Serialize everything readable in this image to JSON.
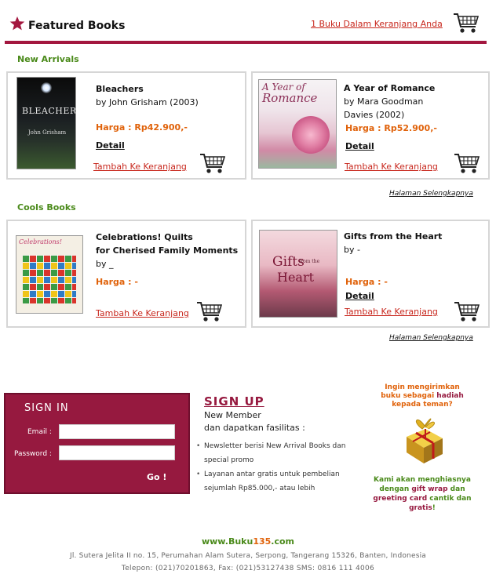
{
  "header": {
    "title": "Featured Books",
    "cart_link": "1 Buku Dalam Keranjang Anda"
  },
  "new_arrivals": {
    "title": "New Arrivals",
    "books": [
      {
        "title": "Bleachers",
        "author": "by John Grisham (2003)",
        "cover_text": "BLEACHERS",
        "cover_author": "John Grisham",
        "price": "Harga : Rp42.900,-",
        "detail": "Detail",
        "add_cart": "Tambah Ke Keranjang"
      },
      {
        "title": "A Year of Romance",
        "author_line1": "by  Mara Goodman",
        "author_line2": "Davies (2002)",
        "cover_text_a": "A Year of",
        "cover_text_b": "Romance",
        "price": "Harga : Rp52.900,-",
        "detail": "Detail",
        "add_cart": "Tambah Ke Keranjang"
      }
    ],
    "more": "Halaman Selengkapnya"
  },
  "cools_books": {
    "title": "Cools Books",
    "books": [
      {
        "title_line1": "Celebrations! Quilts",
        "title_line2": "for Cherised Family Moments",
        "author": "by _",
        "cover_text": "Celebrations!",
        "price": "Harga : -",
        "add_cart": "Tambah Ke Keranjang"
      },
      {
        "title": "Gifts from the Heart",
        "author": "by -",
        "cover_text_a": "Gifts",
        "cover_text_b": "from the",
        "cover_text_c": "Heart",
        "price": "Harga : -",
        "detail": "Detail",
        "add_cart": "Tambah Ke Keranjang"
      }
    ],
    "more": "Halaman Selengkapnya"
  },
  "signin": {
    "title": "SIGN IN",
    "email_label": "Email :",
    "password_label": "Password :",
    "email_value": "",
    "password_value": "",
    "go": "Go !"
  },
  "signup": {
    "title": "SIGN UP",
    "line1": "New Member",
    "line2": "dan dapatkan fasilitas :",
    "bullets": [
      "Newsletter berisi  New Arrival Books dan special promo",
      "Layanan antar gratis untuk pembelian sejumlah Rp85.000,- atau lebih"
    ]
  },
  "promo": {
    "top_a": "Ingin mengirimkan buku sebagai ",
    "top_hl": "hadiah",
    "top_b": " kepada teman?",
    "b1": "Kami akan menghiasnya dengan ",
    "b_gift": "gift wrap",
    "b2": " dan ",
    "b_card": "greeting card",
    "b3": " cantik dan ",
    "b_free": "gratis",
    "b4": "!"
  },
  "footer": {
    "brand_a": "www.Buku",
    "brand_num": "135",
    "brand_b": ".com",
    "address": "Jl. Sutera Jelita II no. 15, Perumahan Alam Sutera, Serpong, Tangerang 15326, Banten, Indonesia",
    "contact": "Telepon:  (021)70201863,  Fax:  (021)53127438    SMS:  0816 111 4006"
  },
  "colors": {
    "accent": "#96193f",
    "orange": "#e0620a",
    "green": "#4a8a1a",
    "link_red": "#c8281e"
  },
  "icons": [
    "star-icon",
    "shopping-cart-icon",
    "gift-box-icon"
  ]
}
